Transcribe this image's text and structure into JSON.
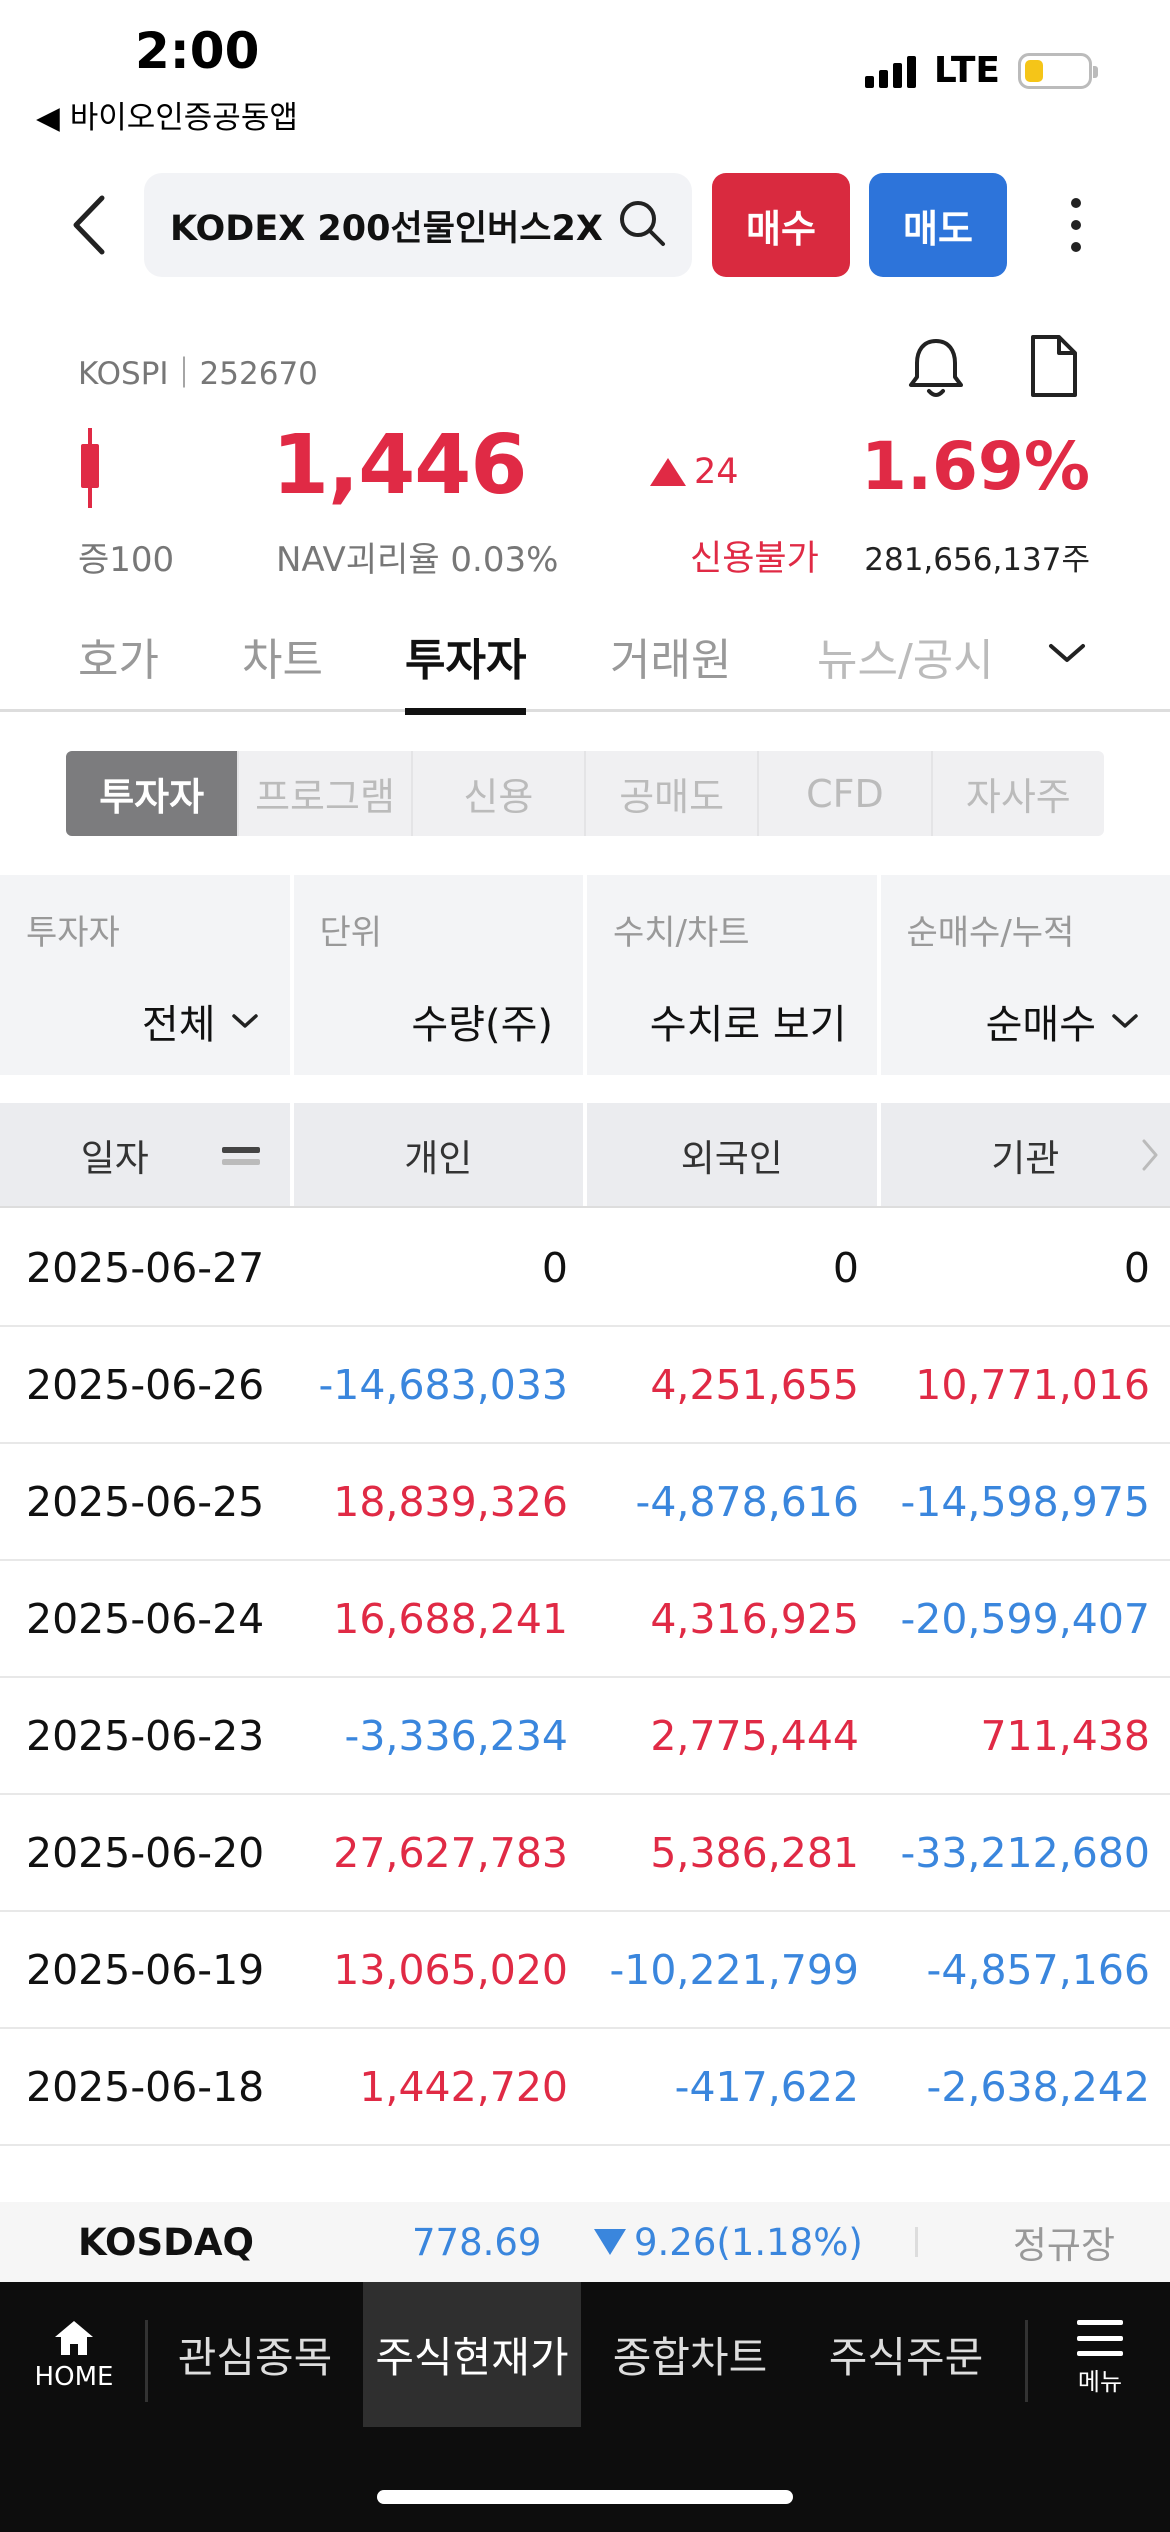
{
  "status_bar": {
    "time": "2:00",
    "back_app": "◀ 바이오인증공동앱",
    "network": "LTE",
    "battery_level": 0.3
  },
  "header": {
    "search_text": "KODEX 200선물인버스2X",
    "buy_label": "매수",
    "sell_label": "매도"
  },
  "stock": {
    "market_code": "KOSPI｜252670",
    "price": "1,446",
    "change_value": "24",
    "change_pct": "1.69%",
    "margin_rate": "증100",
    "nav_gap": "NAV괴리율 0.03%",
    "credit_status": "신용불가",
    "shares": "281,656,137주",
    "up_color": "#e02a45",
    "down_color": "#3a86dd"
  },
  "main_tabs": [
    {
      "label": "호가"
    },
    {
      "label": "차트"
    },
    {
      "label": "투자자"
    },
    {
      "label": "거래원"
    },
    {
      "label": "뉴스/공시"
    }
  ],
  "active_main_tab": "투자자",
  "sub_tabs": [
    {
      "label": "투자자"
    },
    {
      "label": "프로그램"
    },
    {
      "label": "신용"
    },
    {
      "label": "공매도"
    },
    {
      "label": "CFD"
    },
    {
      "label": "자사주"
    }
  ],
  "filters": [
    {
      "label": "투자자",
      "value": "전체"
    },
    {
      "label": "단위",
      "value": "수량(주)"
    },
    {
      "label": "수치/차트",
      "value": "수치로 보기"
    },
    {
      "label": "순매수/누적",
      "value": "순매수"
    }
  ],
  "table": {
    "headers": [
      "일자",
      "개인",
      "외국인",
      "기관"
    ],
    "rows": [
      {
        "date": "2025-06-27",
        "individual": "0",
        "foreign": "0",
        "institution": "0"
      },
      {
        "date": "2025-06-26",
        "individual": "-14,683,033",
        "foreign": "4,251,655",
        "institution": "10,771,016"
      },
      {
        "date": "2025-06-25",
        "individual": "18,839,326",
        "foreign": "-4,878,616",
        "institution": "-14,598,975"
      },
      {
        "date": "2025-06-24",
        "individual": "16,688,241",
        "foreign": "4,316,925",
        "institution": "-20,599,407"
      },
      {
        "date": "2025-06-23",
        "individual": "-3,336,234",
        "foreign": "2,775,444",
        "institution": "711,438"
      },
      {
        "date": "2025-06-20",
        "individual": "27,627,783",
        "foreign": "5,386,281",
        "institution": "-33,212,680"
      },
      {
        "date": "2025-06-19",
        "individual": "13,065,020",
        "foreign": "-10,221,799",
        "institution": "-4,857,166"
      },
      {
        "date": "2025-06-18",
        "individual": "1,442,720",
        "foreign": "-417,622",
        "institution": "-2,638,242"
      }
    ]
  },
  "ticker": {
    "name": "KOSDAQ",
    "value": "778.69",
    "change": "9.26(1.18%)",
    "session": "정규장"
  },
  "bottom_nav": {
    "home_label": "HOME",
    "items": [
      {
        "label": "관심종목"
      },
      {
        "label": "주식현재가"
      },
      {
        "label": "종합차트"
      },
      {
        "label": "주식주문"
      }
    ],
    "menu_label": "메뉴"
  }
}
